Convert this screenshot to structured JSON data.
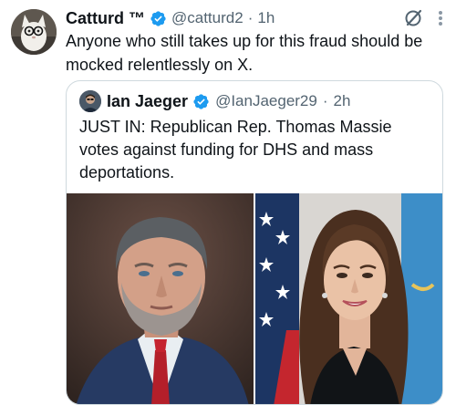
{
  "tweet": {
    "author_name": "Catturd ™",
    "author_handle": "@catturd2",
    "time": "1h",
    "text": "Anyone who still takes up for this fraud should be mocked relentlessly on X."
  },
  "quoted_tweet": {
    "author_name": "Ian Jaeger",
    "author_handle": "@IanJaeger29",
    "time": "2h",
    "text": "JUST IN: Republican Rep. Thomas Massie votes against funding for DHS and mass deportations."
  },
  "icons": {
    "verified": "verified-badge-icon",
    "grok": "grok-icon",
    "more": "more-options-icon"
  },
  "colors": {
    "verified_blue": "#1d9bf0",
    "secondary_text": "#536471",
    "border": "#cfd9de"
  }
}
